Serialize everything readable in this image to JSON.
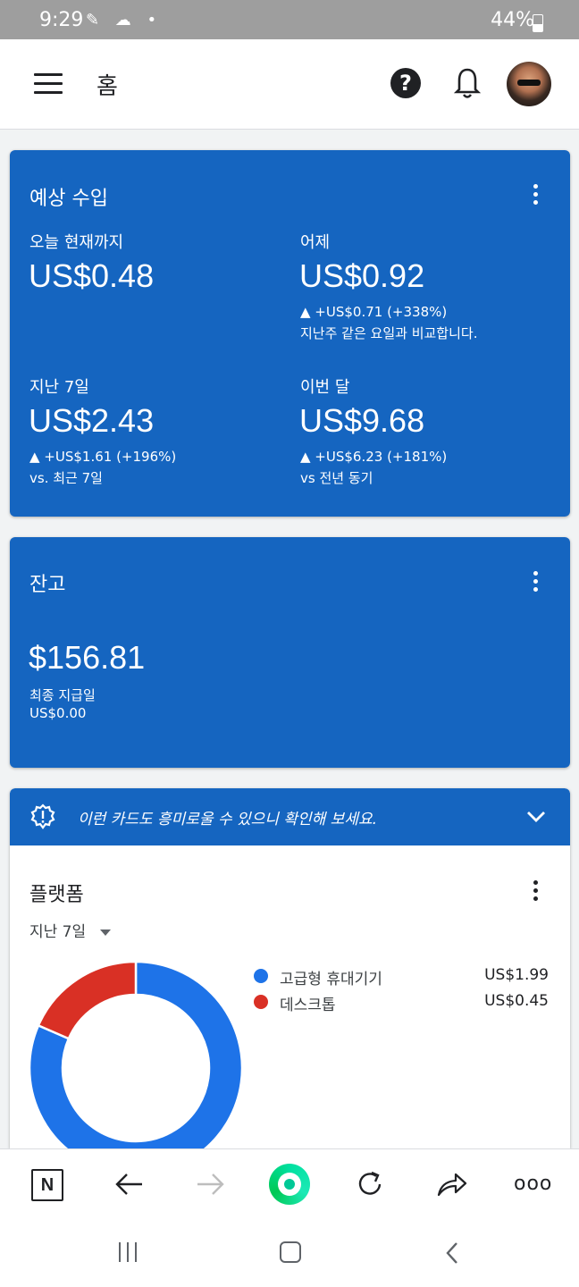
{
  "status": {
    "time": "9:29",
    "battery": "44%"
  },
  "header": {
    "title": "홈"
  },
  "estimated": {
    "title": "예상 수입",
    "today": {
      "label": "오늘 현재까지",
      "value": "US$0.48"
    },
    "yesterday": {
      "label": "어제",
      "value": "US$0.92",
      "delta": "▲ +US$0.71 (+338%)",
      "compare": "지난주 같은 요일과 비교합니다."
    },
    "last7": {
      "label": "지난 7일",
      "value": "US$2.43",
      "delta": "▲ +US$1.61 (+196%)",
      "compare": "vs. 최근 7일"
    },
    "month": {
      "label": "이번 달",
      "value": "US$9.68",
      "delta": "▲ +US$6.23 (+181%)",
      "compare": "vs 전년 동기"
    }
  },
  "balance": {
    "title": "잔고",
    "value": "$156.81",
    "last_payment_label": "최종 지급일",
    "last_payment_value": "US$0.00"
  },
  "platform": {
    "banner": "이런 카드도 흥미로울 수 있으니 확인해 보세요.",
    "title": "플랫폼",
    "period": "지난 7일",
    "legend": [
      {
        "label": "고급형 휴대기기",
        "value": "US$1.99",
        "color": "#1e73e8"
      },
      {
        "label": "데스크톱",
        "value": "US$0.45",
        "color": "#d93025"
      }
    ]
  },
  "chart_data": {
    "type": "pie",
    "categories": [
      "고급형 휴대기기",
      "데스크톱"
    ],
    "values": [
      1.99,
      0.45
    ]
  },
  "bottom_nav": {
    "n_label": "N",
    "more_label": "ooo"
  }
}
